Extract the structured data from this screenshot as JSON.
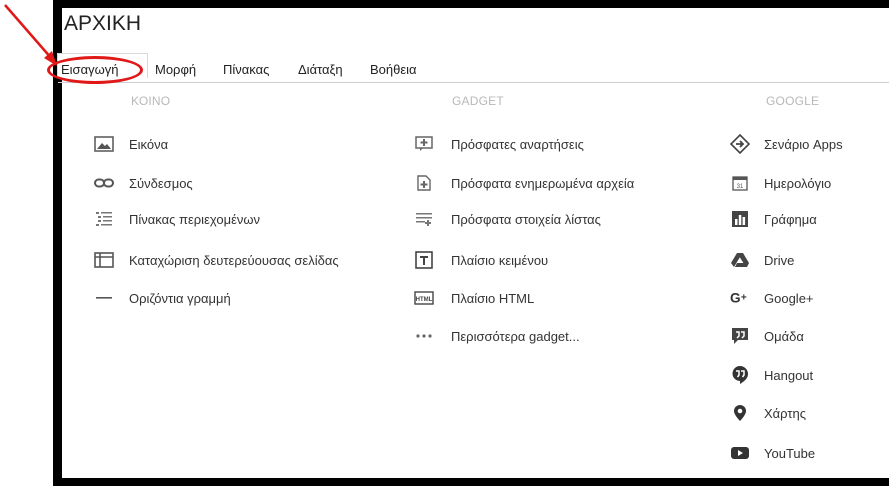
{
  "window_title": "ΑΡΧΙΚΗ",
  "menubar": [
    {
      "label": "Εισαγωγή"
    },
    {
      "label": "Μορφή"
    },
    {
      "label": "Πίνακας"
    },
    {
      "label": "Διάταξη"
    },
    {
      "label": "Βοήθεια"
    }
  ],
  "columns": [
    {
      "header": "ΚΟΙΝΟ",
      "items": [
        {
          "label": "Εικόνα",
          "icon": "image-icon"
        },
        {
          "label": "Σύνδεσμος",
          "icon": "link-icon"
        },
        {
          "label": "Πίνακας περιεχομένων",
          "icon": "table-of-contents-icon"
        },
        {
          "label": "Καταχώριση δευτερεύουσας σελίδας",
          "icon": "subpage-listing-icon"
        },
        {
          "label": "Οριζόντια γραμμή",
          "icon": "horizontal-line-icon"
        }
      ]
    },
    {
      "header": "GADGET",
      "items": [
        {
          "label": "Πρόσφατες αναρτήσεις",
          "icon": "recent-posts-icon"
        },
        {
          "label": "Πρόσφατα ενημερωμένα αρχεία",
          "icon": "recent-files-icon"
        },
        {
          "label": "Πρόσφατα στοιχεία λίστας",
          "icon": "recent-list-items-icon"
        },
        {
          "label": "Πλαίσιο κειμένου",
          "icon": "text-box-icon"
        },
        {
          "label": "Πλαίσιο HTML",
          "icon": "html-box-icon"
        },
        {
          "label": "Περισσότερα gadget...",
          "icon": "more-dots-icon"
        }
      ]
    },
    {
      "header": "GOOGLE",
      "items": [
        {
          "label": "Σενάριο Apps",
          "icon": "apps-script-icon"
        },
        {
          "label": "Ημερολόγιο",
          "icon": "calendar-icon"
        },
        {
          "label": "Γράφημα",
          "icon": "chart-icon"
        },
        {
          "label": "Drive",
          "icon": "drive-icon"
        },
        {
          "label": "Google+",
          "icon": "google-plus-icon"
        },
        {
          "label": "Ομάδα",
          "icon": "group-icon"
        },
        {
          "label": "Hangout",
          "icon": "hangout-icon"
        },
        {
          "label": "Χάρτης",
          "icon": "map-pin-icon"
        },
        {
          "label": "YouTube",
          "icon": "youtube-icon"
        }
      ]
    }
  ],
  "colors": {
    "annotation": "#e01818",
    "header_gray": "#b8b8b8",
    "text": "#333333"
  }
}
